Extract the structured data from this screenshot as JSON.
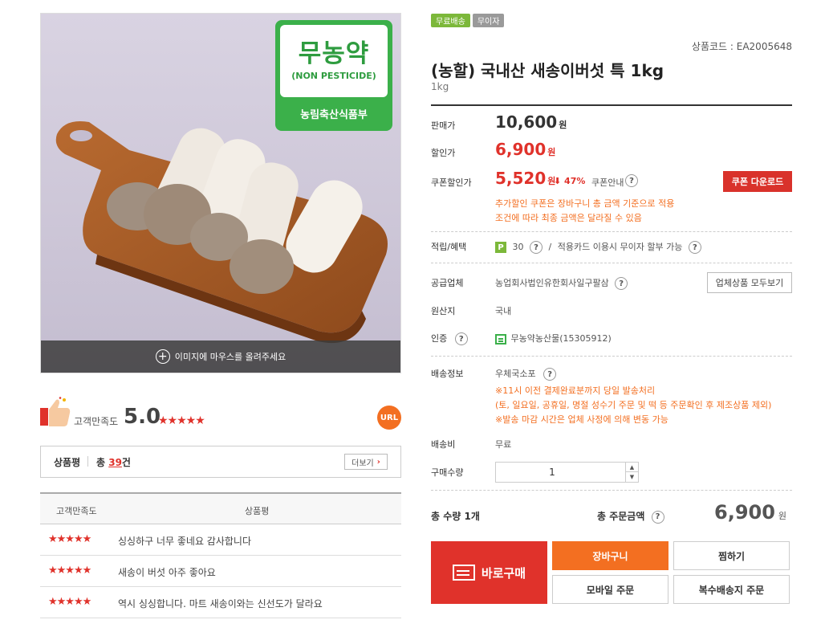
{
  "image": {
    "hover_hint": "이미지에 마우스를 올려주세요",
    "badge": {
      "korean": "무농약",
      "english": "(NON PESTICIDE)",
      "issuer": "농림축산식품부"
    }
  },
  "satisfaction": {
    "label": "고객만족도",
    "score": "5.0",
    "stars": "★★★★★",
    "url_label": "URL"
  },
  "reviews": {
    "title": "상품평",
    "total_prefix": "총 ",
    "count": "39",
    "total_suffix": "건",
    "more_label": "더보기",
    "columns": [
      "고객만족도",
      "상품평"
    ],
    "rows": [
      {
        "stars": "★★★★★",
        "text": "싱싱하구 너무 좋네요 감사합니다"
      },
      {
        "stars": "★★★★★",
        "text": "새송이 버섯 아주 좋아요"
      },
      {
        "stars": "★★★★★",
        "text": "역시 싱싱합니다. 마트 새송이와는 신선도가 달라요"
      }
    ]
  },
  "product": {
    "tags": [
      "무료배송",
      "무이자"
    ],
    "code": "상품코드 : EA2005648",
    "title": "(농할) 국내산 새송이버섯 특 1kg",
    "subtitle": "1kg"
  },
  "pricing": {
    "sale_label": "판매가",
    "sale_price": "10,600",
    "discount_label": "할인가",
    "discount_price": "6,900",
    "coupon_label": "쿠폰할인가",
    "coupon_price": "5,520",
    "won": "원",
    "coupon_rate": "⬇ 47%",
    "coupon_info": "쿠폰안내",
    "coupon_button": "쿠폰 다운로드",
    "coupon_note_1": "추가할인 쿠폰은 장바구니 총 금액 기준으로 적용",
    "coupon_note_2": "조건에 따라 최종 금액은 달라질 수 있음"
  },
  "benefits": {
    "label": "적립/혜택",
    "point_icon": "P",
    "points": "30",
    "separator": "/",
    "card_text": "적용카드 이용시 무이자 할부 가능"
  },
  "supplier": {
    "label": "공급업체",
    "name": "농업회사법인유한회사일구팔삼",
    "button": "업체상품 모두보기"
  },
  "origin": {
    "label": "원산지",
    "value": "국내"
  },
  "certification": {
    "label": "인증",
    "value": "무농약농산물(15305912)"
  },
  "shipping": {
    "label": "배송정보",
    "method": "우체국소포",
    "note_1": "※11시 이전 결제완료분까지 당일 발송처리",
    "note_2": "(토, 일요일, 공휴일, 명절 성수기 주문 및 떡 등 주문확인 후 제조상품 제외)",
    "note_3": "※발송 마감 시간은 업체 사정에 의해 변동 가능",
    "fee_label": "배송비",
    "fee_value": "무료"
  },
  "quantity": {
    "label": "구매수량",
    "value": "1"
  },
  "totals": {
    "qty_text": "총 수량 1개",
    "amount_label": "총 주문금액",
    "amount": "6,900",
    "won": "원"
  },
  "buttons": {
    "buy_now": "바로구매",
    "cart": "장바구니",
    "wish": "찜하기",
    "mobile_order": "모바일 주문",
    "multi_address": "복수배송지 주문"
  },
  "colors": {
    "accent_red": "#e0322b",
    "accent_orange": "#f36f21",
    "tag_green": "#7cb83a",
    "cert_green": "#3bb04a"
  }
}
